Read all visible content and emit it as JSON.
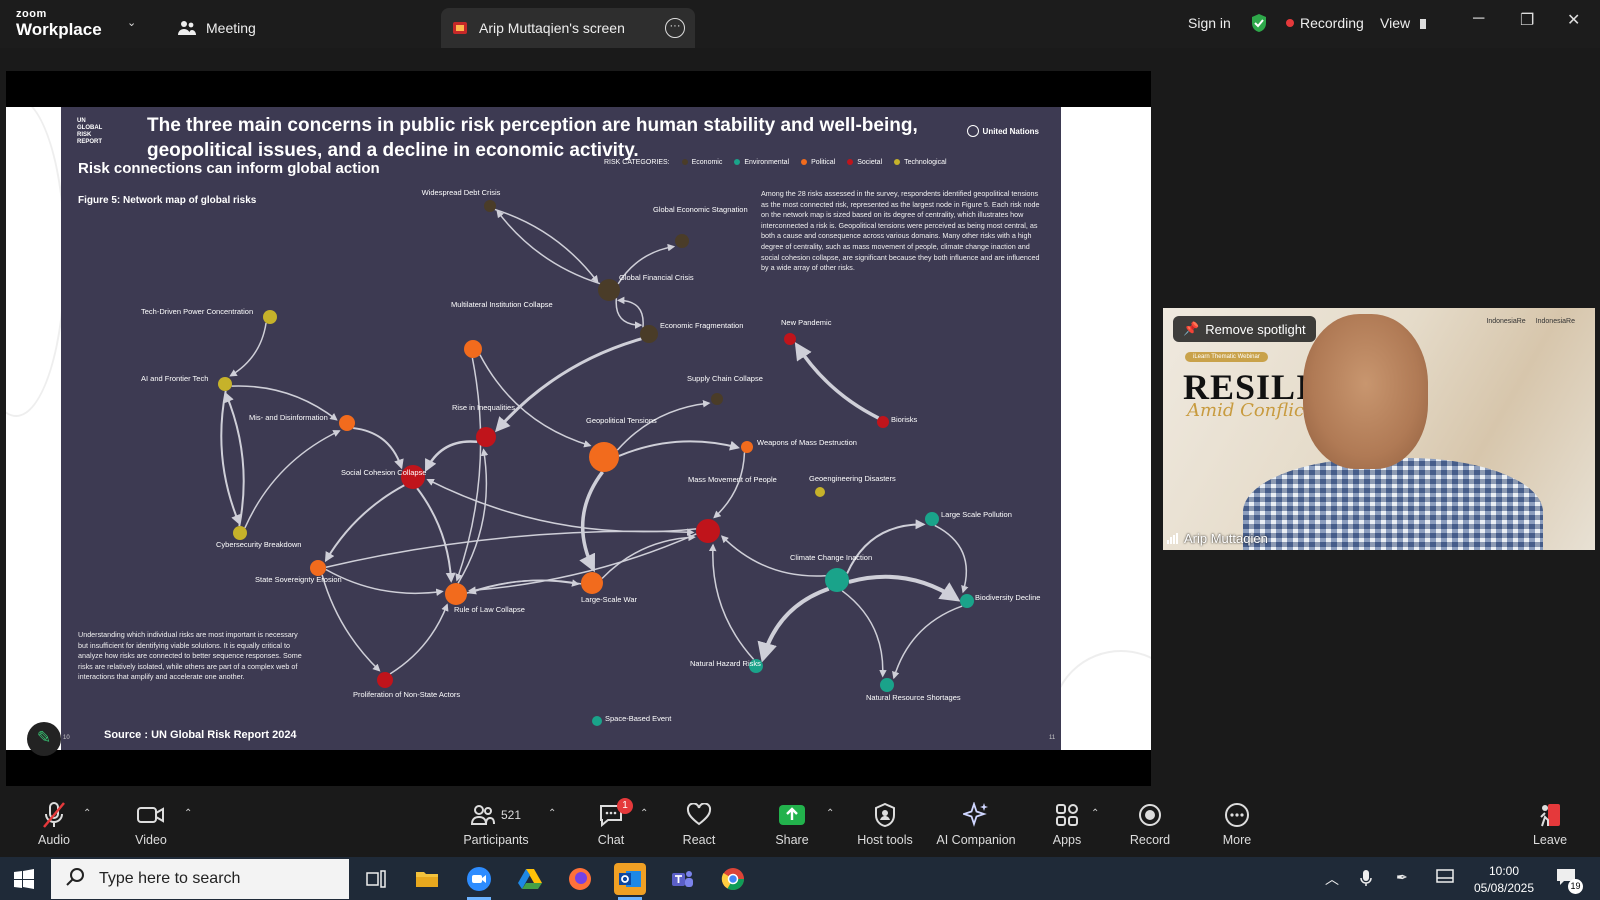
{
  "app": {
    "logo_top": "zoom",
    "logo_bottom": "Workplace",
    "tabs": [
      {
        "label": "Meeting"
      },
      {
        "label": "Arip Muttaqien's screen"
      }
    ],
    "sign_in": "Sign in",
    "recording": "Recording",
    "view": "View"
  },
  "slide": {
    "logo_lines": "UN GLOBAL RISK REPORT",
    "title_line1": "The three main concerns in public risk perception are human stability and well-being,",
    "title_line2": "geopolitical issues, and a decline in economic activity.",
    "subtitle": "Risk connections can inform global action",
    "un_label": "United Nations",
    "risk_categories_label": "RISK CATEGORIES:",
    "legend": [
      {
        "label": "Economic",
        "color": "#4a3c28"
      },
      {
        "label": "Environmental",
        "color": "#1aa38a"
      },
      {
        "label": "Political",
        "color": "#f26b1d"
      },
      {
        "label": "Societal",
        "color": "#c0141b"
      },
      {
        "label": "Technological",
        "color": "#c6b22a"
      }
    ],
    "figure_caption": "Figure 5: Network map of global risks",
    "para_right": "Among the 28 risks assessed in the survey, respondents identified geopolitical tensions as the most connected risk, represented as the largest node in Figure 5. Each risk node on the network map is sized based on its degree of centrality, which illustrates how interconnected a risk is. Geopolitical tensions were perceived as being most central, as both a cause and consequence across various domains. Many other risks with a high degree of centrality, such as mass movement of people, climate change inaction and social cohesion collapse, are significant because they both influence and are influenced by a wide array of other risks.",
    "para_left": "Understanding which individual risks are most important is necessary but insufficient for identifying viable solutions. It is equally critical to analyze how risks are connected to better sequence responses. Some risks are relatively isolated, while others are part of a complex web of interactions that amplify and accelerate one another.",
    "source": "Source : UN Global Risk Report 2024",
    "page_left": "10",
    "page_right": "11",
    "nodes": [
      {
        "id": "debt",
        "label": "Widespread Debt Crisis",
        "cat": "Economic"
      },
      {
        "id": "stag",
        "label": "Global Economic Stagnation",
        "cat": "Economic"
      },
      {
        "id": "fin",
        "label": "Global Financial Crisis",
        "cat": "Economic"
      },
      {
        "id": "frag",
        "label": "Economic Fragmentation",
        "cat": "Economic"
      },
      {
        "id": "tdpc",
        "label": "Tech-Driven Power Concentration",
        "cat": "Technological"
      },
      {
        "id": "multi",
        "label": "Multilateral Institution Collapse",
        "cat": "Political"
      },
      {
        "id": "pand",
        "label": "New Pandemic",
        "cat": "Societal"
      },
      {
        "id": "supply",
        "label": "Supply Chain Collapse",
        "cat": "Economic"
      },
      {
        "id": "ai",
        "label": "AI and Frontier Tech",
        "cat": "Technological"
      },
      {
        "id": "misinfo",
        "label": "Mis- and Disinformation",
        "cat": "Political"
      },
      {
        "id": "ineq",
        "label": "Rise in Inequalities",
        "cat": "Societal"
      },
      {
        "id": "geo",
        "label": "Geopolitical Tensions",
        "cat": "Political"
      },
      {
        "id": "bio",
        "label": "Biorisks",
        "cat": "Societal"
      },
      {
        "id": "wmd",
        "label": "Weapons of Mass Destruction",
        "cat": "Political"
      },
      {
        "id": "social",
        "label": "Social Cohesion Collapse",
        "cat": "Societal"
      },
      {
        "id": "geoeng",
        "label": "Geoengineering Disasters",
        "cat": "Technological"
      },
      {
        "id": "mass",
        "label": "Mass Movement of People",
        "cat": "Societal"
      },
      {
        "id": "pollution",
        "label": "Large Scale Pollution",
        "cat": "Environmental"
      },
      {
        "id": "cyber",
        "label": "Cybersecurity Breakdown",
        "cat": "Technological"
      },
      {
        "id": "climate",
        "label": "Climate Change Inaction",
        "cat": "Environmental"
      },
      {
        "id": "sov",
        "label": "State Sovereignty Erosion",
        "cat": "Political"
      },
      {
        "id": "war",
        "label": "Large-Scale War",
        "cat": "Political"
      },
      {
        "id": "biodiv",
        "label": "Biodiversity Decline",
        "cat": "Environmental"
      },
      {
        "id": "law",
        "label": "Rule of Law Collapse",
        "cat": "Political"
      },
      {
        "id": "hazard",
        "label": "Natural Hazard Risks",
        "cat": "Environmental"
      },
      {
        "id": "nonstate",
        "label": "Proliferation of Non-State Actors",
        "cat": "Societal"
      },
      {
        "id": "resource",
        "label": "Natural Resource Shortages",
        "cat": "Environmental"
      },
      {
        "id": "space",
        "label": "Space-Based Event",
        "cat": "Environmental"
      }
    ]
  },
  "video": {
    "spotlight_button": "Remove spotlight",
    "participant_name": "Arip Muttaqien",
    "banner_tag": "iLearn Thematic Webinar",
    "banner_title": "RESILIE",
    "banner_script": "Amid Conflict",
    "logo_1": "IndonesiaRe",
    "logo_2": "IndonesiaRe"
  },
  "toolbar": {
    "audio": "Audio",
    "video": "Video",
    "participants": "Participants",
    "participants_count": "521",
    "chat": "Chat",
    "chat_badge": "1",
    "react": "React",
    "share": "Share",
    "host_tools": "Host tools",
    "ai_companion": "AI Companion",
    "apps": "Apps",
    "record": "Record",
    "more": "More",
    "leave": "Leave"
  },
  "taskbar": {
    "search_placeholder": "Type here to search",
    "time": "10:00",
    "date": "05/08/2025",
    "notification_count": "19"
  }
}
